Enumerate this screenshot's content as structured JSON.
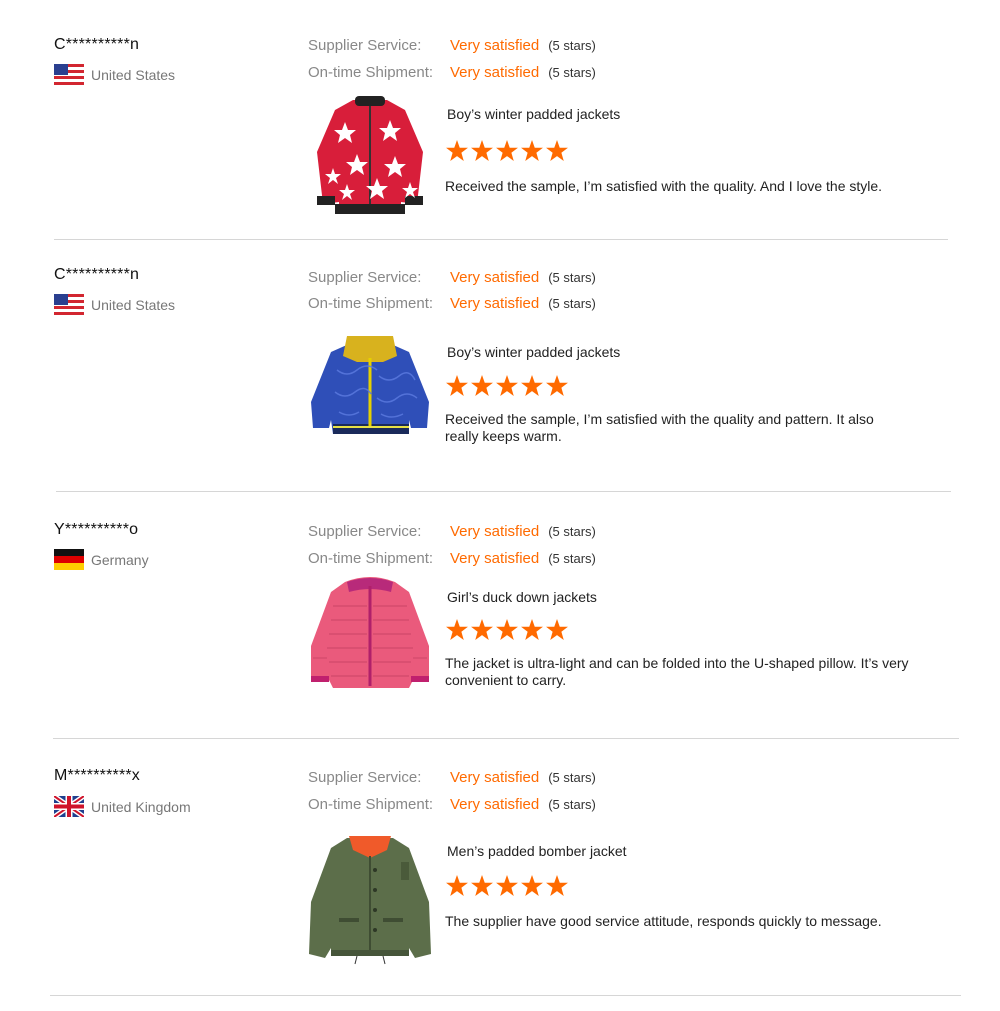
{
  "reviews": [
    {
      "buyer": "C**********n",
      "country": "United States",
      "flag": "us-flag",
      "supplier_label": "Supplier Service:",
      "supplier_value": "Very satisfied",
      "supplier_stars": "(5 stars)",
      "shipment_label": "On-time Shipment:",
      "shipment_value": "Very satisfied",
      "shipment_stars": "(5 stars)",
      "product": "Boy’s winter padded jackets",
      "rating": 5,
      "comment": "Received the sample, I’m satisfied with the quality. And I love the style."
    },
    {
      "buyer": "C**********n",
      "country": "United States",
      "flag": "us-flag",
      "supplier_label": "Supplier Service:",
      "supplier_value": "Very satisfied",
      "supplier_stars": "(5 stars)",
      "shipment_label": "On-time Shipment:",
      "shipment_value": "Very satisfied",
      "shipment_stars": "(5 stars)",
      "product": "Boy’s winter padded jackets",
      "rating": 5,
      "comment": "Received the sample, I’m satisfied with the quality and pattern. It  also really keeps warm."
    },
    {
      "buyer": "Y**********o",
      "country": "Germany",
      "flag": "de-flag",
      "supplier_label": "Supplier Service:",
      "supplier_value": "Very satisfied",
      "supplier_stars": "(5 stars)",
      "shipment_label": "On-time Shipment:",
      "shipment_value": "Very satisfied",
      "shipment_stars": "(5 stars)",
      "product": "Girl’s duck down jackets",
      "rating": 5,
      "comment": "The jacket is ultra-light and can be folded into the U-shaped pillow. It’s very convenient to carry."
    },
    {
      "buyer": "M**********x",
      "country": "United Kingdom",
      "flag": "uk-flag",
      "supplier_label": "Supplier Service:",
      "supplier_value": "Very satisfied",
      "supplier_stars": "(5 stars)",
      "shipment_label": "On-time Shipment:",
      "shipment_value": "Very satisfied",
      "shipment_stars": "(5 stars)",
      "product": "Men’s padded bomber jacket",
      "rating": 5,
      "comment": "The supplier have good service attitude, responds quickly to message."
    }
  ],
  "colors": {
    "accent": "#ff6a00",
    "label": "#888888",
    "divider": "#d6d6d6"
  }
}
